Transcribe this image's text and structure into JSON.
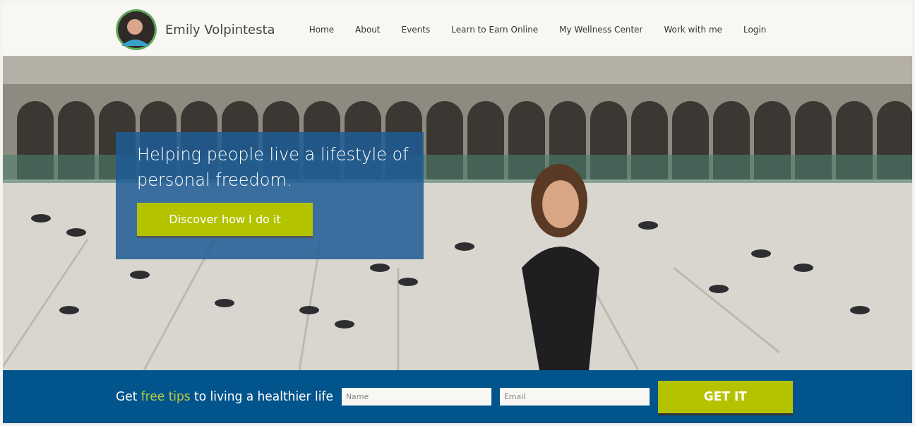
{
  "header": {
    "site_name": "Emily Volpintesta",
    "nav": [
      {
        "label": "Home"
      },
      {
        "label": "About"
      },
      {
        "label": "Events"
      },
      {
        "label": "Learn to Earn Online"
      },
      {
        "label": "My Wellness Center"
      },
      {
        "label": "Work with me"
      },
      {
        "label": "Login"
      }
    ]
  },
  "hero": {
    "kind": "picture",
    "headline": "Helping people live a lifestyle of personal freedom.",
    "button": "Discover how I do it"
  },
  "signup": {
    "tagline": {
      "before": "Get",
      "highlight": "free tips",
      "after": "to living a healthier life"
    },
    "fields": [
      {
        "placeholder": "Name"
      },
      {
        "placeholder": "Email"
      }
    ],
    "button": "GET IT"
  }
}
